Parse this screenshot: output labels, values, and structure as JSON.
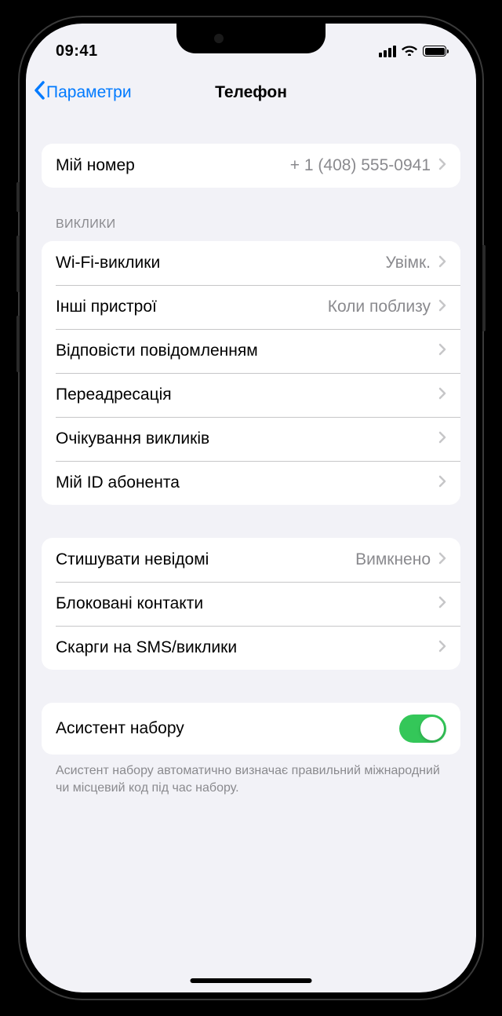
{
  "status": {
    "time": "09:41"
  },
  "nav": {
    "back": "Параметри",
    "title": "Телефон"
  },
  "myNumber": {
    "label": "Мій номер",
    "value": "+ 1 (408) 555-0941"
  },
  "calls": {
    "header": "ВИКЛИКИ",
    "wifi": {
      "label": "Wi-Fi-виклики",
      "value": "Увімк."
    },
    "other": {
      "label": "Інші пристрої",
      "value": "Коли поблизу"
    },
    "respond": {
      "label": "Відповісти повідомленням"
    },
    "forward": {
      "label": "Переадресація"
    },
    "waiting": {
      "label": "Очікування викликів"
    },
    "callerId": {
      "label": "Мій ID абонента"
    }
  },
  "block": {
    "silence": {
      "label": "Стишувати невідомі",
      "value": "Вимкнено"
    },
    "blocked": {
      "label": "Блоковані контакти"
    },
    "report": {
      "label": "Скарги на SMS/виклики"
    }
  },
  "dial": {
    "label": "Асистент набору",
    "footer": "Асистент набору автоматично визначає правильний міжнародний чи місцевий код під час набору."
  }
}
